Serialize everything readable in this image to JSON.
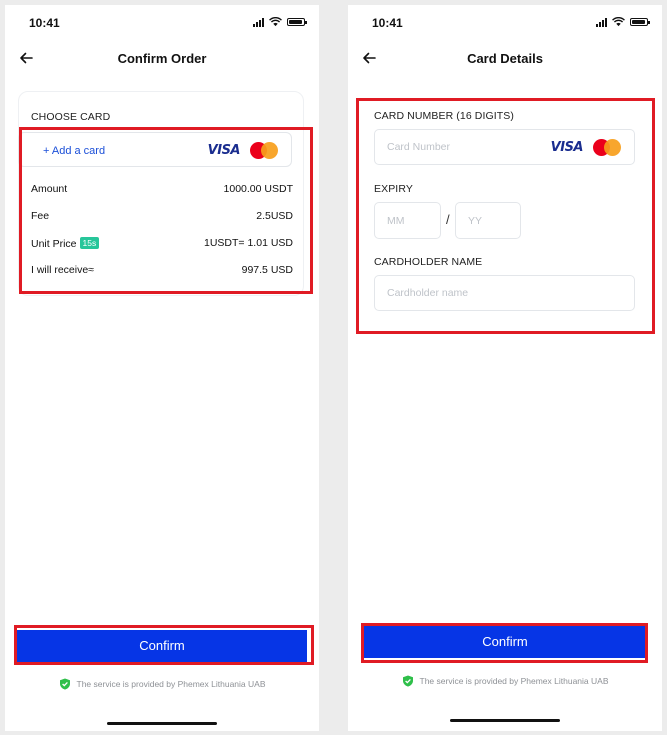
{
  "left_screen": {
    "status": {
      "time": "10:41"
    },
    "title": "Confirm Order",
    "choose_card_label": "CHOOSE CARD",
    "add_card_label": "+ Add a card",
    "brands": {
      "visa": "VISA"
    },
    "rows": [
      {
        "label": "Amount",
        "value": "1000.00 USDT"
      },
      {
        "label": "Fee",
        "value": "2.5USD"
      },
      {
        "label": "Unit Price",
        "badge": "15s",
        "value": "1USDT= 1.01 USD"
      },
      {
        "label": "I will receive≈",
        "value": "997.5 USD"
      }
    ],
    "confirm_label": "Confirm",
    "footer": "The service is provided by Phemex Lithuania UAB"
  },
  "right_screen": {
    "status": {
      "time": "10:41"
    },
    "title": "Card Details",
    "card_number_label": "CARD NUMBER (16 DIGITS)",
    "card_number_placeholder": "Card Number",
    "brands": {
      "visa": "VISA"
    },
    "expiry_label": "EXPIRY",
    "expiry_month_placeholder": "MM",
    "expiry_separator": "/",
    "expiry_year_placeholder": "YY",
    "cardholder_label": "CARDHOLDER NAME",
    "cardholder_placeholder": "Cardholder name",
    "confirm_label": "Confirm",
    "footer": "The service is provided by Phemex Lithuania UAB"
  },
  "colors": {
    "primary_button": "#0635e6",
    "highlight": "#e01b24",
    "link": "#1b4fd8",
    "timer_badge": "#27c69a",
    "shield": "#2fbf4a"
  },
  "icons": [
    "back-arrow-icon",
    "signal-icon",
    "wifi-icon",
    "battery-icon",
    "visa-logo",
    "mastercard-icon",
    "shield-check-icon"
  ]
}
